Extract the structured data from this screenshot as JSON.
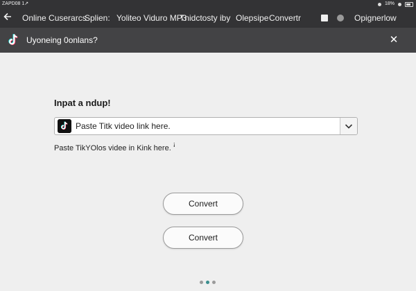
{
  "status_bar": {
    "time": "ZAPD08 1↗",
    "right_text": "18%"
  },
  "nav": {
    "items": [
      {
        "label": "Online Cuserarcs"
      },
      {
        "label": "Splien:"
      },
      {
        "label": "Yoliteo Viduro MP3"
      },
      {
        "label": "Tnidctosty iby"
      },
      {
        "label": "Olepsipe"
      },
      {
        "label": "Convertr"
      }
    ],
    "right_label": "Opignerlow"
  },
  "header": {
    "title": "Uyoneing 0onlans?",
    "close_glyph": "✕"
  },
  "form": {
    "label": "Inpat a ndup!",
    "input_value": "Paste Titk video link here.",
    "helper": "Paste TikYOlos videe in Kink here. ꜞ"
  },
  "buttons": {
    "convert_1": "Convert",
    "convert_2": "Convert"
  },
  "pager": {
    "count": 3,
    "active_index": 1
  },
  "colors": {
    "chrome": "#333335",
    "header": "#434345",
    "page_bg": "#efefef",
    "accent_teal": "#3a8e8e",
    "tiktok_cyan": "#25f4ee",
    "tiktok_pink": "#fe2c55"
  },
  "icons": {
    "back": "arrow-left-icon",
    "logo": "tiktok-logo-icon",
    "close": "close-icon",
    "dropdown": "chevron-down-icon"
  }
}
